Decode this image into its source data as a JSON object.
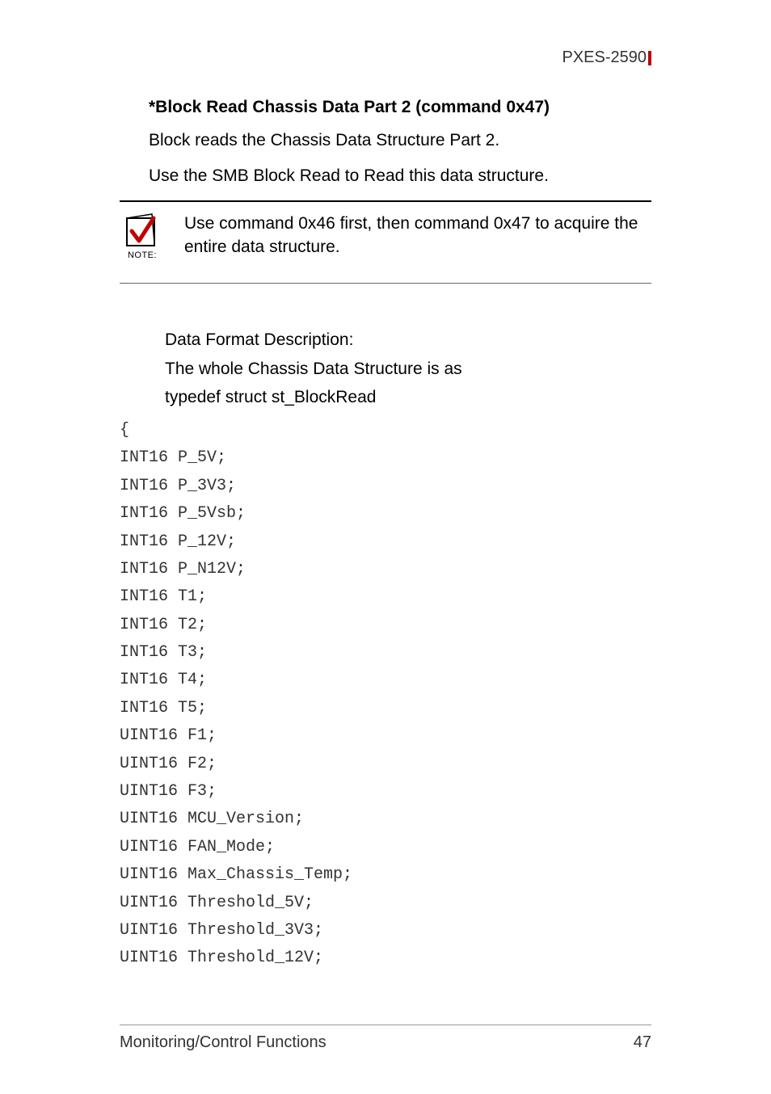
{
  "header": {
    "product": "PXES-2590"
  },
  "section": {
    "title": "*Block Read Chassis Data Part 2 (command 0x47)",
    "para1": "Block reads the Chassis Data Structure Part 2.",
    "para2": "Use the SMB Block Read to Read this data structure."
  },
  "note": {
    "caption": "NOTE:",
    "text": "Use command 0x46 first, then command 0x47 to acquire the entire data structure."
  },
  "description": {
    "line1": "Data Format Description:",
    "line2": "The whole Chassis Data Structure is as",
    "line3": "typedef struct st_BlockRead"
  },
  "code": "{\nINT16 P_5V;\nINT16 P_3V3;\nINT16 P_5Vsb;\nINT16 P_12V;\nINT16 P_N12V;\nINT16 T1;\nINT16 T2;\nINT16 T3;\nINT16 T4;\nINT16 T5;\nUINT16 F1;\nUINT16 F2;\nUINT16 F3;\nUINT16 MCU_Version;\nUINT16 FAN_Mode;\nUINT16 Max_Chassis_Temp;\nUINT16 Threshold_5V;\nUINT16 Threshold_3V3;\nUINT16 Threshold_12V;",
  "footer": {
    "section": "Monitoring/Control Functions",
    "page": "47"
  }
}
